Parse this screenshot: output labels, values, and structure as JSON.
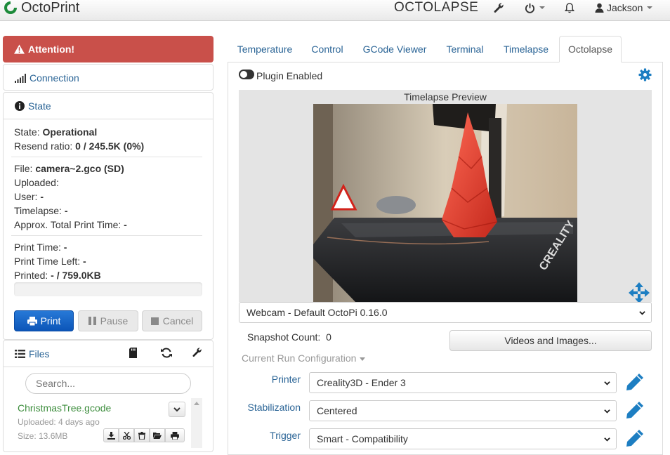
{
  "navbar": {
    "brand": "OctoPrint",
    "title": "OCTOLAPSE",
    "user": "Jackson",
    "icons": [
      "wrench-icon",
      "power-icon",
      "bell-icon",
      "user-icon"
    ]
  },
  "sidebar": {
    "attention": "Attention!",
    "connection": "Connection",
    "state_title": "State",
    "state": {
      "state_label": "State:",
      "state_value": "Operational",
      "resend_label": "Resend ratio:",
      "resend_value": "0 / 245.5K (0%)",
      "file_label": "File:",
      "file_value": "camera~2.gco (SD)",
      "uploaded_label": "Uploaded:",
      "user_label": "User:",
      "user_value": "-",
      "timelapse_label": "Timelapse:",
      "timelapse_value": "-",
      "total_label": "Approx. Total Print Time:",
      "total_value": "-",
      "printtime_label": "Print Time:",
      "printtime_value": "-",
      "left_label": "Print Time Left:",
      "left_value": "-",
      "printed_label": "Printed:",
      "printed_value": "- / 759.0KB",
      "progress": 0
    },
    "buttons": {
      "print": "Print",
      "pause": "Pause",
      "cancel": "Cancel"
    },
    "files": {
      "title": "Files",
      "search_placeholder": "Search...",
      "items": [
        {
          "name": "ChristmasTree.gcode",
          "uploaded": "Uploaded: 4 days ago",
          "size": "Size: 13.6MB"
        }
      ]
    }
  },
  "tabs": [
    "Temperature",
    "Control",
    "GCode Viewer",
    "Terminal",
    "Timelapse",
    "Octolapse"
  ],
  "octolapse": {
    "plugin_enabled": "Plugin Enabled",
    "preview_title": "Timelapse Preview",
    "webcam": "Webcam - Default OctoPi 0.16.0",
    "snapshot_label": "Snapshot Count:",
    "snapshot_value": "0",
    "videos_button": "Videos and Images...",
    "run_config": "Current Run Configuration",
    "printer_label": "Printer",
    "printer_value": "Creality3D - Ender 3",
    "stabilization_label": "Stabilization",
    "stabilization_value": "Centered",
    "trigger_label": "Trigger",
    "trigger_value": "Smart - Compatibility",
    "webcam_text": "CREALITY"
  },
  "colors": {
    "attention": "#c9504a",
    "primary": "#1565c0",
    "link": "#2a6496",
    "file_green": "#3e8e3e",
    "accent_icon": "#1d7ec2"
  }
}
